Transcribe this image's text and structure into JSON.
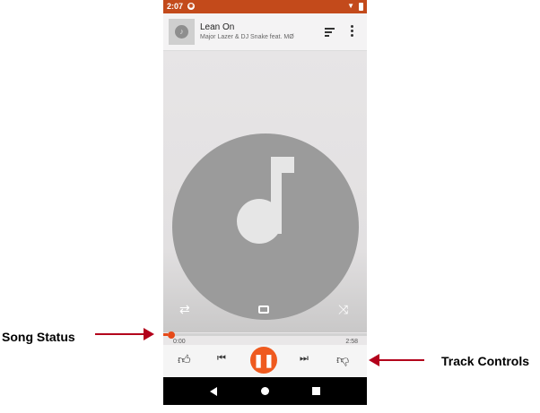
{
  "status_bar": {
    "time": "2:07"
  },
  "now_playing": {
    "title": "Lean On",
    "artist": "Major Lazer & DJ Snake feat. MØ"
  },
  "playback": {
    "elapsed": "0:00",
    "duration": "2:58",
    "progress_fraction": 0.02,
    "state": "playing"
  },
  "icons": {
    "header": [
      "album-thumbnail",
      "queue-icon",
      "more-icon"
    ],
    "art_controls": [
      "repeat-icon",
      "cast-icon",
      "shuffle-icon"
    ],
    "track_controls": [
      "thumbs-up-icon",
      "previous-icon",
      "pause-icon",
      "next-icon",
      "thumbs-down-icon"
    ],
    "nav": [
      "back-icon",
      "home-icon",
      "recents-icon"
    ]
  },
  "annotations": {
    "song_status": "Song Status",
    "track_controls": "Track Controls"
  },
  "colors": {
    "status_bar": "#c34a1b",
    "accent": "#ef5a1f",
    "arrow": "#b3001b"
  }
}
